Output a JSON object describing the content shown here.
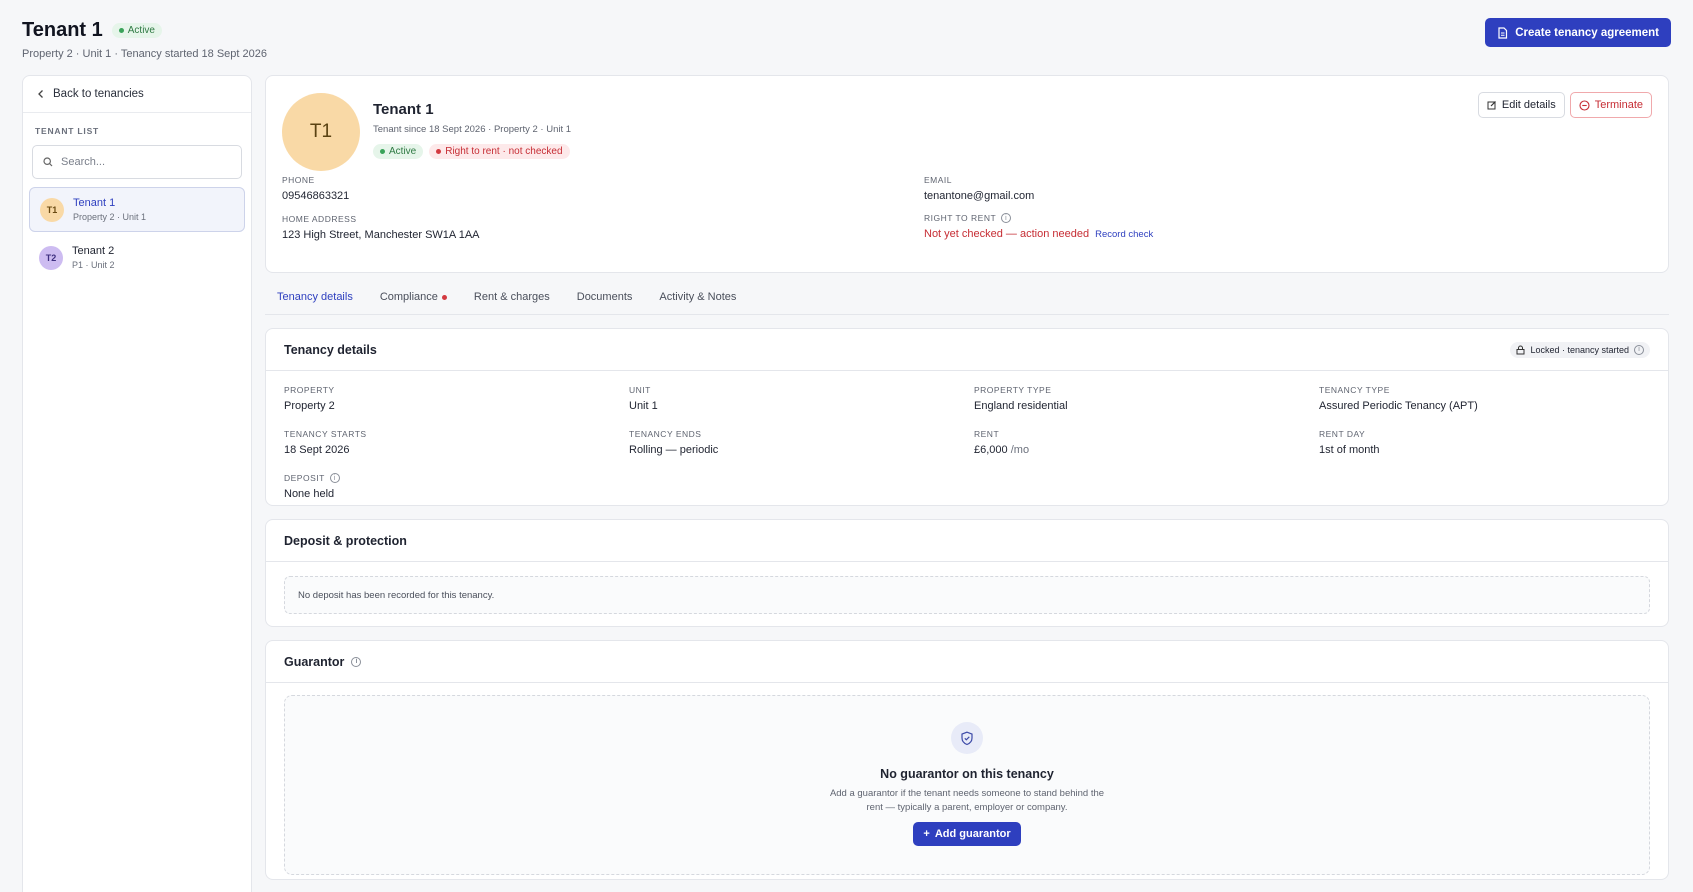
{
  "header": {
    "title": "Tenant 1",
    "status": "Active",
    "subtitle": "Property 2 · Unit 1 · Tenancy started 18 Sept 2026",
    "create_button": "Create tenancy agreement"
  },
  "sidebar": {
    "back_label": "Back to tenancies",
    "heading": "TENANT LIST",
    "search_placeholder": "Search...",
    "items": [
      {
        "initials": "T1",
        "name": "Tenant 1",
        "sub": "Property 2 · Unit 1"
      },
      {
        "initials": "T2",
        "name": "Tenant 2",
        "sub": "P1 · Unit 2"
      }
    ]
  },
  "profile": {
    "initials": "T1",
    "name": "Tenant 1",
    "sub": "Tenant since 18 Sept 2026 · Property 2 · Unit 1",
    "badge_active": "Active",
    "badge_rtr": "Right to rent · not checked",
    "edit_button": "Edit details",
    "terminate_button": "Terminate",
    "phone_label": "PHONE",
    "phone": "09546863321",
    "email_label": "EMAIL",
    "email": "tenantone@gmail.com",
    "address_label": "HOME ADDRESS",
    "address": "123 High Street, Manchester SW1A 1AA",
    "rtr_label": "RIGHT TO RENT",
    "rtr_value": "Not yet checked — action needed",
    "rtr_link": "Record check"
  },
  "tabs": [
    "Tenancy details",
    "Compliance",
    "Rent & charges",
    "Documents",
    "Activity & Notes"
  ],
  "tenancy": {
    "title": "Tenancy details",
    "lock_label": "Locked · tenancy started",
    "property_label": "PROPERTY",
    "property": "Property 2",
    "unit_label": "UNIT",
    "unit": "Unit 1",
    "ptype_label": "PROPERTY TYPE",
    "ptype": "England residential",
    "ttype_label": "TENANCY TYPE",
    "ttype": "Assured Periodic Tenancy (APT)",
    "starts_label": "TENANCY STARTS",
    "starts": "18 Sept 2026",
    "ends_label": "TENANCY ENDS",
    "ends": "Rolling — periodic",
    "rent_label": "RENT",
    "rent": "£6,000",
    "rent_unit": "/mo",
    "rentday_label": "RENT DAY",
    "rentday": "1st of month",
    "deposit_label": "DEPOSIT",
    "deposit": "None held"
  },
  "deposit": {
    "title": "Deposit & protection",
    "empty": "No deposit has been recorded for this tenancy."
  },
  "guarantor": {
    "title": "Guarantor",
    "empty_title": "No guarantor on this tenancy",
    "empty_text": "Add a guarantor if the tenant needs someone to stand behind the rent — typically a parent, employer or company.",
    "add_button": "Add guarantor"
  }
}
